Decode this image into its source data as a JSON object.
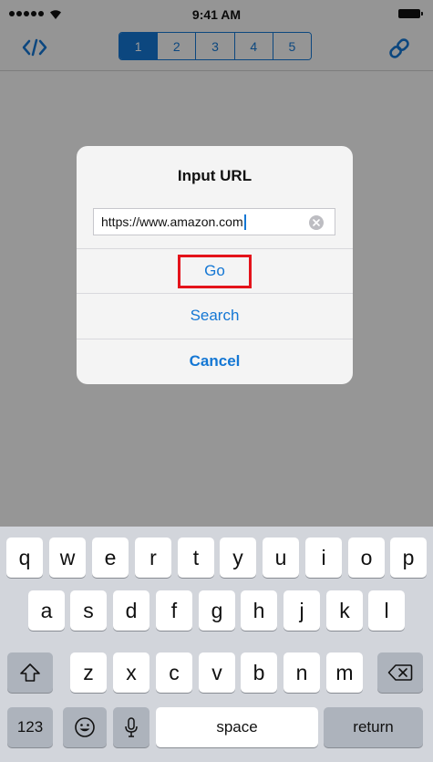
{
  "status_bar": {
    "time": "9:41 AM"
  },
  "nav": {
    "segments": [
      "1",
      "2",
      "3",
      "4",
      "5"
    ],
    "active_segment": 0,
    "accent_color": "#1477d4"
  },
  "alert": {
    "title": "Input URL",
    "url_value": "https://www.amazon.com",
    "buttons": {
      "go": "Go",
      "search": "Search",
      "cancel": "Cancel"
    },
    "highlight_color": "#e4131b"
  },
  "keyboard": {
    "row1": [
      "q",
      "w",
      "e",
      "r",
      "t",
      "y",
      "u",
      "i",
      "o",
      "p"
    ],
    "row2": [
      "a",
      "s",
      "d",
      "f",
      "g",
      "h",
      "j",
      "k",
      "l"
    ],
    "row3": [
      "z",
      "x",
      "c",
      "v",
      "b",
      "n",
      "m"
    ],
    "numbers_key": "123",
    "space_key": "space",
    "return_key": "return",
    "icons": {
      "shift": "shift-icon",
      "delete": "backspace-icon",
      "emoji": "emoji-icon",
      "mic": "microphone-icon"
    }
  }
}
